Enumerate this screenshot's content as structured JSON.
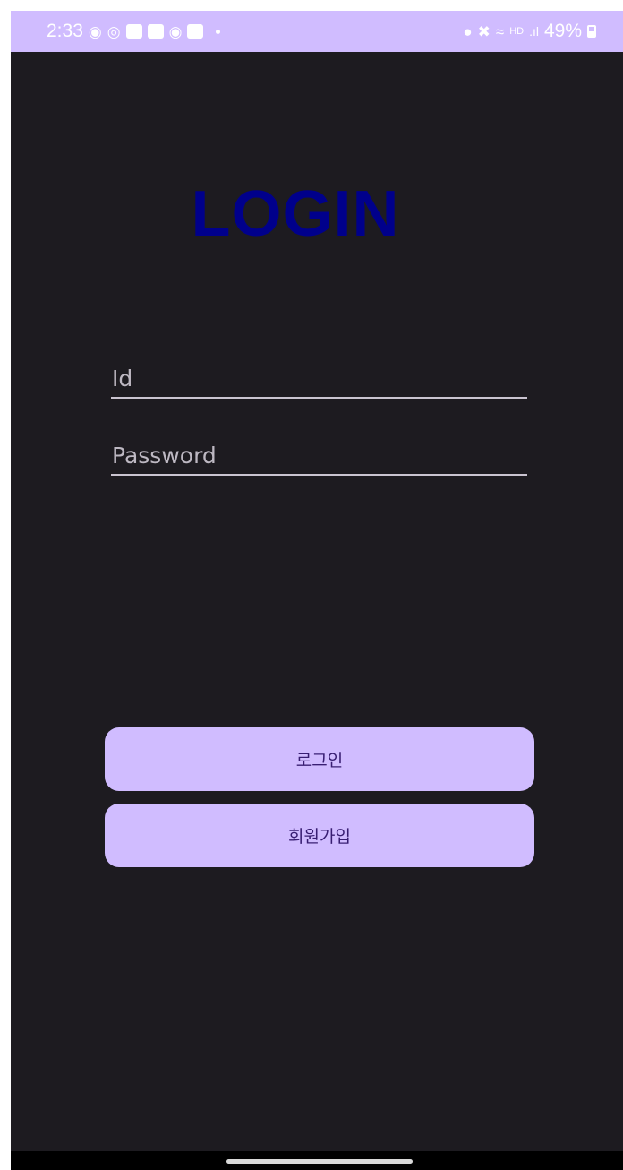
{
  "status_bar": {
    "time": "2:33",
    "battery": "49%",
    "left_icons": [
      "chat-bubble-icon",
      "instagram-icon",
      "image-app-icon",
      "note-app-icon",
      "facebook-icon",
      "mail-app-icon"
    ],
    "right_icons": [
      "alarm-icon",
      "mute-icon",
      "wifi-icon",
      "hd-signal-icon",
      "signal-bars-icon",
      "battery-icon"
    ]
  },
  "screen": {
    "title": "LOGIN",
    "title_color": "#00008b",
    "background": "#1d1b20",
    "accent": "#d0bcff"
  },
  "form": {
    "id_field": {
      "value": "",
      "placeholder": "Id"
    },
    "password_field": {
      "value": "",
      "placeholder": "Password"
    }
  },
  "buttons": {
    "login_label": "로그인",
    "signup_label": "회원가입"
  }
}
